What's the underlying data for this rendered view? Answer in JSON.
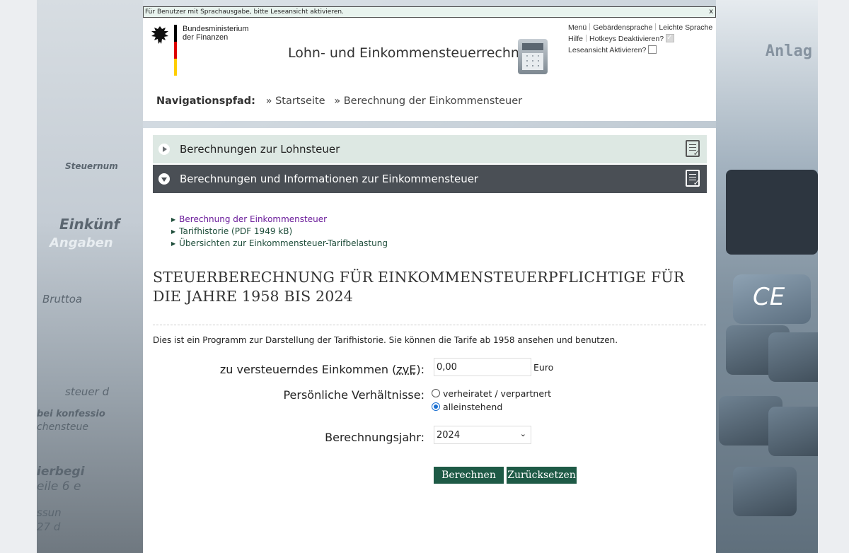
{
  "notice": {
    "text": "Für Benutzer mit Sprachausgabe, bitte Leseansicht aktivieren.",
    "close": "x"
  },
  "brand": {
    "ministry_line1": "Bundesministerium",
    "ministry_line2": "der Finanzen",
    "app_title": "Lohn- und Einkommensteuerrechner",
    "flag_colors": [
      "#000000",
      "#dd0000",
      "#ffce00"
    ]
  },
  "toplinks": {
    "menu": "Menü",
    "sign_language": "Gebärdensprache",
    "easy_language": "Leichte Sprache",
    "help": "Hilfe",
    "hotkeys": "Hotkeys Deaktivieren?",
    "hotkeys_checked": true,
    "reader_view": "Leseansicht Aktivieren?",
    "reader_view_checked": false
  },
  "breadcrumb": {
    "label": "Navigationspfad:",
    "items": [
      "» Startseite",
      "» Berechnung der Einkommensteuer"
    ]
  },
  "accordion": [
    {
      "label": "Berechnungen zur Lohnsteuer",
      "expanded": false
    },
    {
      "label": "Berechnungen und Informationen zur Einkommensteuer",
      "expanded": true
    }
  ],
  "links": [
    "Berechnung der Einkommensteuer",
    "Tarifhistorie (PDF 1949 kB)",
    "Übersichten zur Einkommensteuer-Tarifbelastung"
  ],
  "heading": "STEUERBERECHNUNG FÜR EINKOMMENSTEUERPFLICHTIGE FÜR DIE JAHRE 1958 BIS 2024",
  "intro": "Dies ist ein Programm zur Darstellung der Tarifhistorie. Sie können die Tarife ab 1958 ansehen und benutzen.",
  "form": {
    "income_label": "zu versteuerndes Einkommen (",
    "income_abbr": "zvE",
    "income_label_end": "):",
    "income_value": "0,00",
    "income_unit": "Euro",
    "status_label": "Persönliche Verhältnisse:",
    "status_options": [
      "verheiratet / verpartnert",
      "alleinstehend"
    ],
    "status_selected": "alleinstehend",
    "year_label": "Berechnungsjahr:",
    "year_value": "2024",
    "calculate": "Berechnen",
    "reset": "Zurücksetzen"
  },
  "colors": {
    "accent": "#1e5a46",
    "accordion_active": "#4a4f55",
    "accordion_inactive": "#dde8e3",
    "visited_link": "#6a1b9a"
  }
}
